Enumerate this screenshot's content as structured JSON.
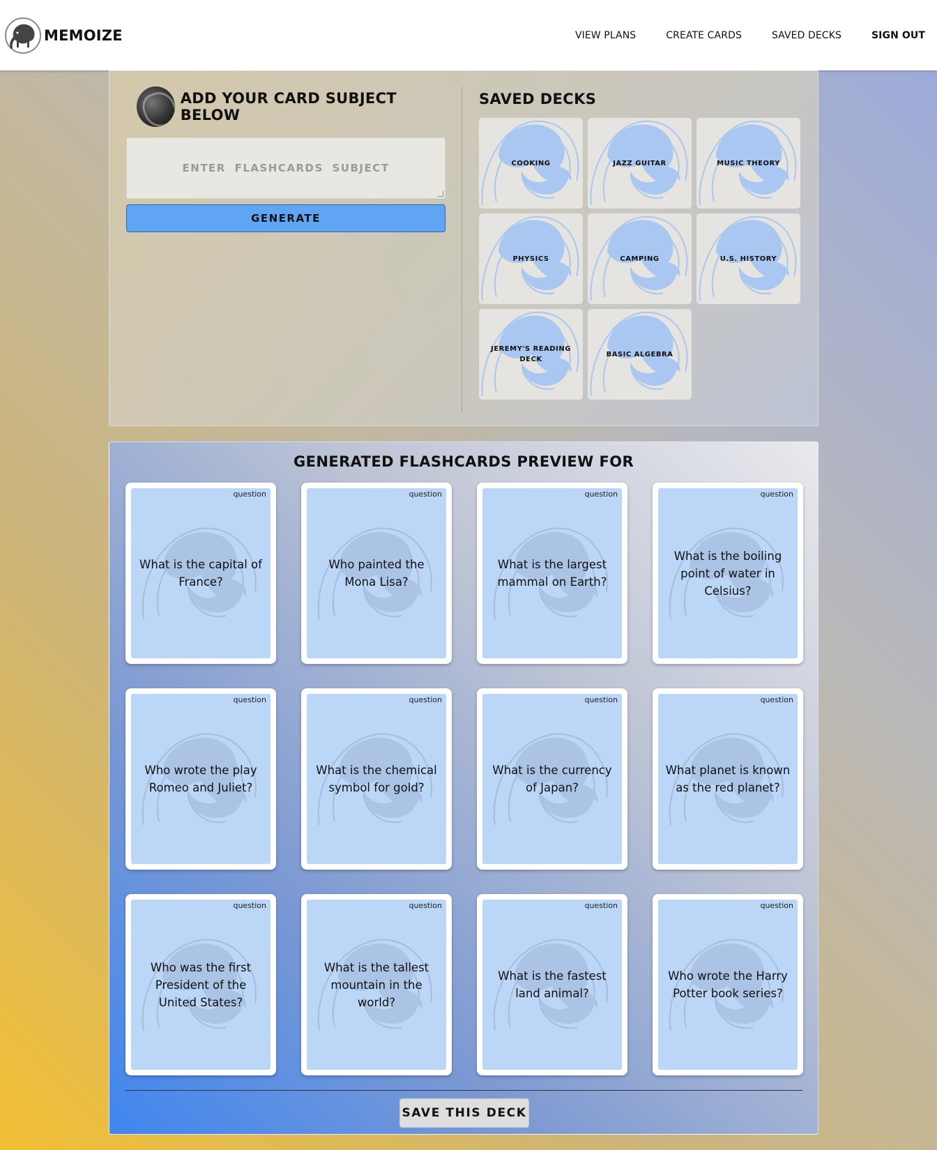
{
  "nav": {
    "brand": "MEMOIZE",
    "links": [
      {
        "label": "VIEW PLANS"
      },
      {
        "label": "CREATE CARDS"
      },
      {
        "label": "SAVED DECKS"
      },
      {
        "label": "SIGN OUT"
      }
    ]
  },
  "subject": {
    "title": "ADD YOUR CARD SUBJECT BELOW",
    "placeholder": "ENTER FLASHCARDS SUBJECT",
    "generate_label": "GENERATE"
  },
  "saved": {
    "title": "SAVED DECKS",
    "decks": [
      {
        "label": "COOKING"
      },
      {
        "label": "JAZZ GUITAR"
      },
      {
        "label": "MUSIC THEORY"
      },
      {
        "label": "PHYSICS"
      },
      {
        "label": "CAMPING"
      },
      {
        "label": "U.S. HISTORY"
      },
      {
        "label": "JEREMY'S READING DECK"
      },
      {
        "label": "BASIC ALGEBRA"
      }
    ]
  },
  "preview": {
    "title": "GENERATED FLASHCARDS PREVIEW FOR",
    "cards": [
      {
        "tag": "question",
        "text": "What is the capital of France?"
      },
      {
        "tag": "question",
        "text": "Who painted the Mona Lisa?"
      },
      {
        "tag": "question",
        "text": "What is the largest mammal on Earth?"
      },
      {
        "tag": "question",
        "text": "What is the boiling point of water in Celsius?"
      },
      {
        "tag": "question",
        "text": "Who wrote the play Romeo and Juliet?"
      },
      {
        "tag": "question",
        "text": "What is the chemical symbol for gold?"
      },
      {
        "tag": "question",
        "text": "What is the currency of Japan?"
      },
      {
        "tag": "question",
        "text": "What planet is known as the red planet?"
      },
      {
        "tag": "question",
        "text": "Who was the first President of the United States?"
      },
      {
        "tag": "question",
        "text": "What is the tallest mountain in the world?"
      },
      {
        "tag": "question",
        "text": "What is the fastest land animal?"
      },
      {
        "tag": "question",
        "text": "Who wrote the Harry Potter book series?"
      }
    ],
    "save_label": "SAVE THIS DECK"
  },
  "colors": {
    "generate": "#60a4f4",
    "card_face": "#bcd6f7",
    "deck_elephant": "#a9c7f0"
  },
  "icons": {
    "logo": "elephant-logo-icon",
    "deck_bg": "elephant-watermark-icon",
    "avatar": "user-avatar"
  }
}
